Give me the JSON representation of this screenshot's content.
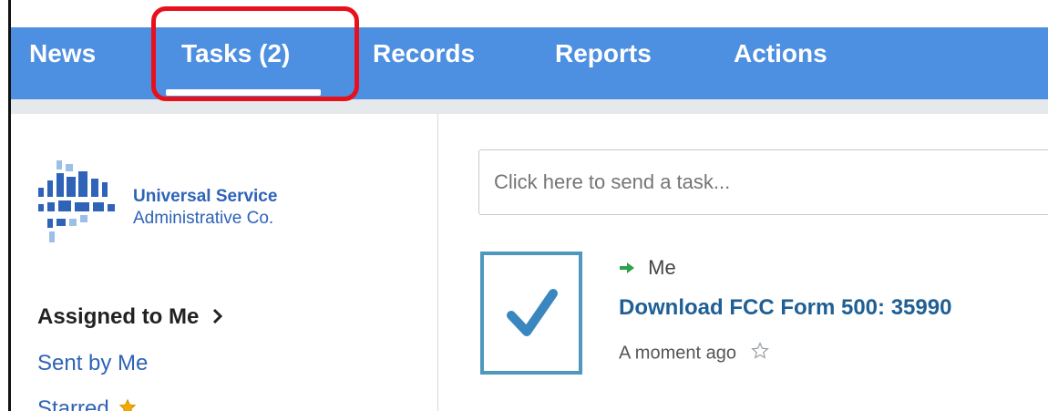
{
  "nav": {
    "tabs": [
      {
        "label": "News"
      },
      {
        "label": "Tasks (2)"
      },
      {
        "label": "Records"
      },
      {
        "label": "Reports"
      },
      {
        "label": "Actions"
      }
    ],
    "active_tab": "Tasks (2)"
  },
  "colors": {
    "nav_bg": "#4d8fe0",
    "highlight": "#e8101a",
    "accent": "#2e63b8",
    "task_title": "#1f5f94",
    "check": "#3a86bf",
    "arrow": "#2fa14b",
    "starred": "#f2a900"
  },
  "logo": {
    "line1": "Universal Service",
    "line2": "Administrative Co."
  },
  "sidebar": {
    "items": [
      {
        "label": "Assigned to Me",
        "icon": "chevron-right-icon"
      },
      {
        "label": "Sent by Me"
      },
      {
        "label": "Starred",
        "icon": "star-filled-icon"
      }
    ]
  },
  "search": {
    "placeholder": "Click here to send a task..."
  },
  "task": {
    "assignee": "Me",
    "title": "Download FCC Form 500: 35990",
    "time": "A moment ago",
    "icons": [
      "checkmark-icon",
      "arrow-right-icon",
      "star-outline-icon"
    ]
  }
}
